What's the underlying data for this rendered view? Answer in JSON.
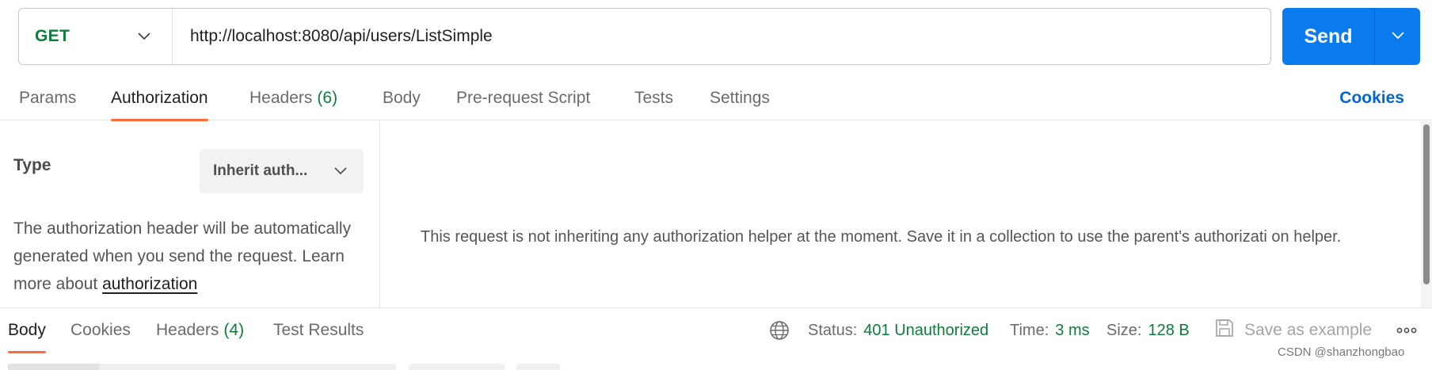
{
  "request": {
    "method": "GET",
    "url": "http://localhost:8080/api/users/ListSimple",
    "send_label": "Send"
  },
  "request_tabs": [
    {
      "label": "Params"
    },
    {
      "label": "Authorization"
    },
    {
      "label": "Headers",
      "count": "(6)"
    },
    {
      "label": "Body"
    },
    {
      "label": "Pre-request Script"
    },
    {
      "label": "Tests"
    },
    {
      "label": "Settings"
    }
  ],
  "cookies_label": "Cookies",
  "auth": {
    "type_label": "Type",
    "type_value": "Inherit auth...",
    "description": "The authorization header will be automatically generated when you send the request. Learn more about ",
    "link_text": "authorization",
    "inherit_message": "This request is not inheriting any authorization helper at the moment. Save it in a collection to use the parent's authorizati on helper."
  },
  "response": {
    "tabs": [
      {
        "label": "Body"
      },
      {
        "label": "Cookies"
      },
      {
        "label": "Headers",
        "count": "(4)"
      },
      {
        "label": "Test Results"
      }
    ],
    "status_label": "Status:",
    "status_value": "401 Unauthorized",
    "time_label": "Time:",
    "time_value": "3 ms",
    "size_label": "Size:",
    "size_value": "128 B",
    "save_label": "Save as example"
  },
  "watermark": "CSDN @shanzhongbao",
  "colors": {
    "method_green": "#0b7e3a",
    "send_blue": "#097bed",
    "active_tab_orange": "#ff6c37",
    "link_blue": "#0265d2"
  },
  "icons": {
    "method_dropdown": "chevron-down-icon",
    "send_dropdown": "chevron-down-icon",
    "type_dropdown": "chevron-down-icon",
    "network": "globe-icon",
    "save": "save-icon",
    "more": "more-horizontal-icon"
  }
}
